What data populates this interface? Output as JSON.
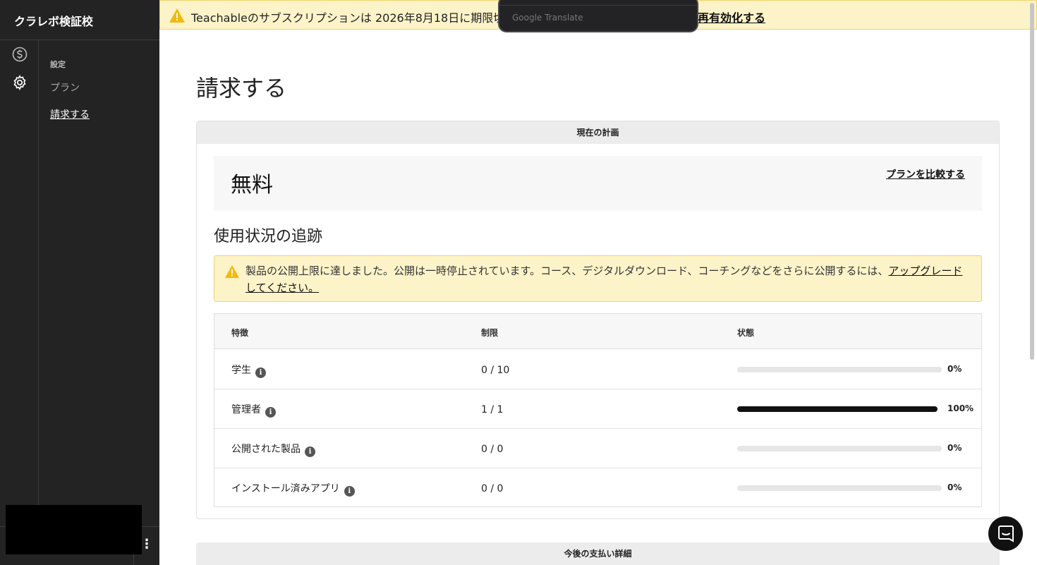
{
  "sidebar": {
    "school_name": "クラレボ検証校",
    "section_label": "設定",
    "items": [
      {
        "label": "プラン",
        "active": false
      },
      {
        "label": "請求する",
        "active": true
      }
    ]
  },
  "banner": {
    "text": "Teachableのサブスクリプションは 2026年8月18日に期限切れ",
    "link": "再有効化する"
  },
  "translate_popup": {
    "label": "Google Translate"
  },
  "page": {
    "title": "請求する"
  },
  "current_plan": {
    "header": "現在の計画",
    "plan_name": "無料",
    "compare_link": "プランを比較する"
  },
  "usage": {
    "title": "使用状況の追跡",
    "alert_text": "製品の公開上限に達しました。公開は一時停止されています。コース、デジタルダウンロード、コーチングなどをさらに公開するには、",
    "alert_link": "アップグレードしてください。",
    "columns": [
      "特徴",
      "制限",
      "状態"
    ],
    "rows": [
      {
        "feature": "学生",
        "limit": "0 / 10",
        "percent": "0%",
        "fraction": 0
      },
      {
        "feature": "管理者",
        "limit": "1 / 1",
        "percent": "100%",
        "fraction": 1
      },
      {
        "feature": "公開された製品",
        "limit": "0 / 0",
        "percent": "0%",
        "fraction": 0
      },
      {
        "feature": "インストール済みアプリ",
        "limit": "0 / 0",
        "percent": "0%",
        "fraction": 0
      }
    ]
  },
  "upcoming": {
    "header": "今後の支払い詳細"
  },
  "icons": {
    "billing": "dollar-circle-icon",
    "settings": "gear-icon",
    "warning": "warning-triangle-icon",
    "info": "info-icon",
    "chat": "chat-bubble-icon",
    "kebab": "kebab-menu-icon"
  },
  "colors": {
    "sidebar_bg": "#232323",
    "alert_bg": "#fdf3c9",
    "alert_border": "#f1d36a",
    "warning_icon": "#f2b90c",
    "bar_fill": "#111111",
    "bar_track": "#e6e6e6"
  }
}
